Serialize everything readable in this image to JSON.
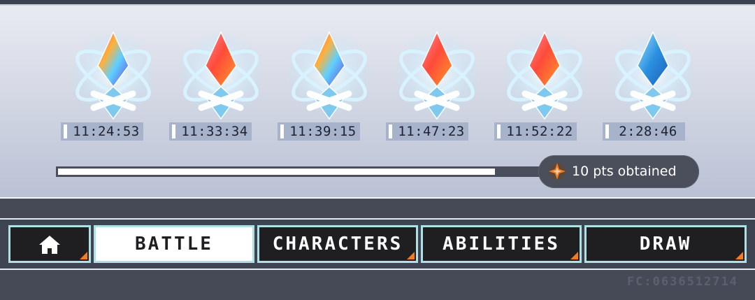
{
  "crystals": [
    {
      "icon": "rainbow-crystal-icon",
      "timer": "11:24:53"
    },
    {
      "icon": "red-crystal-icon",
      "timer": "11:33:34"
    },
    {
      "icon": "rainbow-crystal-icon",
      "timer": "11:39:15"
    },
    {
      "icon": "red-crystal-icon",
      "timer": "11:47:23"
    },
    {
      "icon": "red-crystal-icon",
      "timer": "11:52:22"
    },
    {
      "icon": "blue-crystal-icon",
      "timer": "2:28:46"
    }
  ],
  "progress": {
    "fraction": 0.9
  },
  "points": {
    "icon": "star-icon",
    "text": "10 pts obtained"
  },
  "nav": {
    "home_icon": "home-icon",
    "battle": "BATTLE",
    "characters": "CHARACTERS",
    "abilities": "ABILITIES",
    "draw": "DRAW"
  },
  "friend_code": "FC:0636512714",
  "colors": {
    "accent": "#f47b25",
    "tab_border": "#aee0e6",
    "glow": "#a9e4ff"
  }
}
